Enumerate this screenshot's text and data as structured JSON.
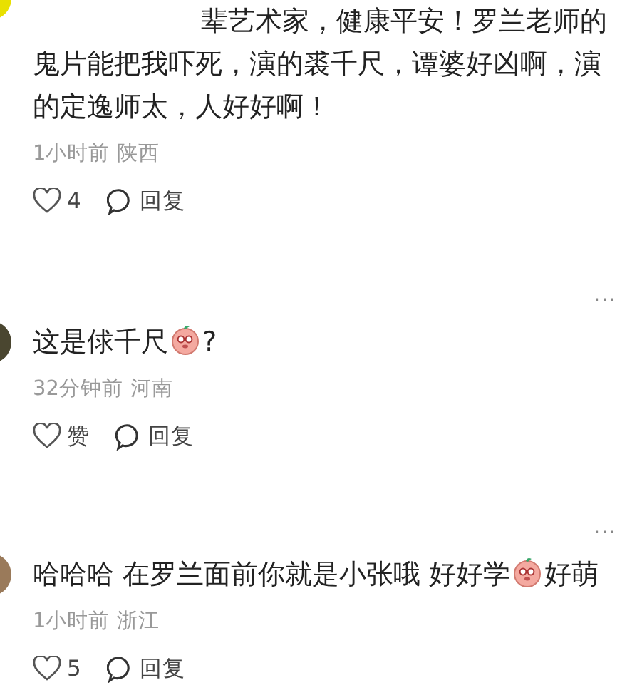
{
  "comments": [
    {
      "first_line": "辈艺术家，健康平安！罗兰老师的",
      "content": [
        {
          "kind": "text",
          "text": "鬼片能把我吓死，演的裘千尺，谭婆好凶啊，演的定逸师太，人好好啊！"
        }
      ],
      "time": "1小时前",
      "location": "陕西",
      "like_label": "4",
      "reply_label": "回复"
    },
    {
      "more_label": "···",
      "content": [
        {
          "kind": "text",
          "text": "这是俅千尺"
        },
        {
          "kind": "emoji"
        },
        {
          "kind": "text",
          "text": "?"
        }
      ],
      "time": "32分钟前",
      "location": "河南",
      "like_label": "赞",
      "reply_label": "回复"
    },
    {
      "more_label": "···",
      "content": [
        {
          "kind": "text",
          "text": "哈哈哈 在罗兰面前你就是小张哦 好好学"
        },
        {
          "kind": "emoji"
        },
        {
          "kind": "text",
          "text": "好萌"
        }
      ],
      "time": "1小时前",
      "location": "浙江",
      "like_label": "5",
      "reply_label": "回复"
    }
  ]
}
